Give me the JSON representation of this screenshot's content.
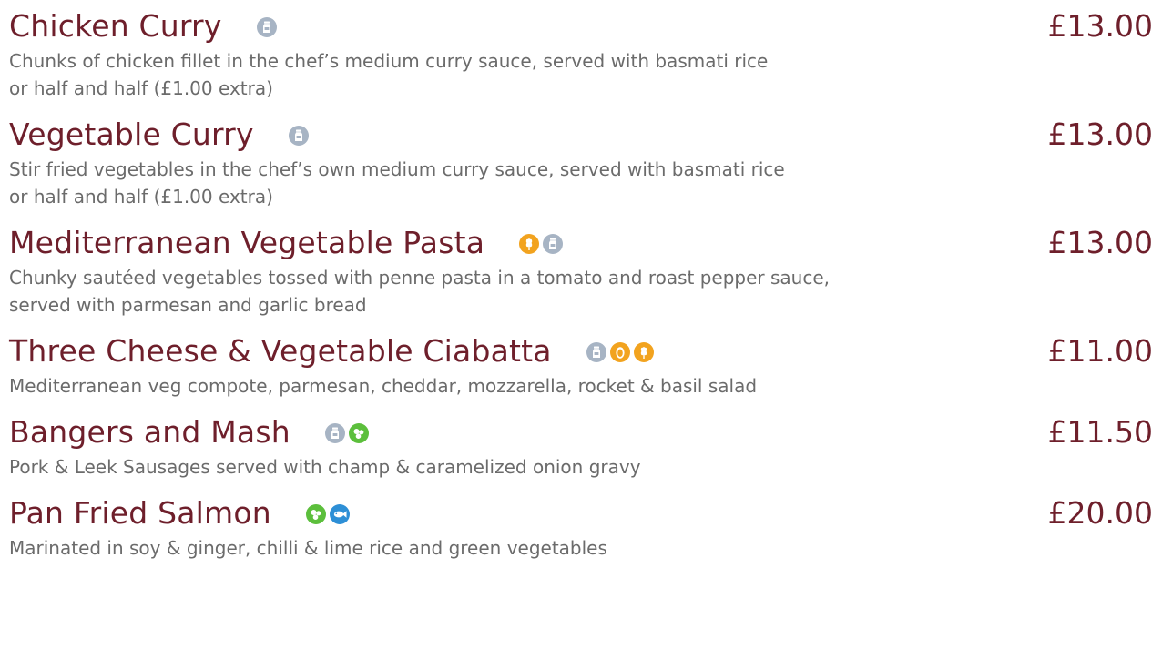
{
  "menu": {
    "items": [
      {
        "name": "Chicken Curry",
        "price": "£13.00",
        "description": "Chunks of chicken fillet in the chef’s medium curry sauce, served with basmati rice\nor half and half (£1.00 extra)",
        "allergens": [
          "milk-icon"
        ]
      },
      {
        "name": "Vegetable Curry",
        "price": "£13.00",
        "description": "Stir fried vegetables in the chef’s own medium curry sauce, served with basmati rice\nor half and half (£1.00 extra)",
        "allergens": [
          "milk-icon"
        ]
      },
      {
        "name": "Mediterranean Vegetable Pasta",
        "price": "£13.00",
        "description": "Chunky sautéed vegetables tossed with penne pasta in a tomato and roast pepper sauce,\nserved with parmesan and garlic bread",
        "allergens": [
          "gluten-icon",
          "milk-icon"
        ]
      },
      {
        "name": "Three Cheese & Vegetable Ciabatta",
        "price": "£11.00",
        "description": "Mediterranean veg compote, parmesan, cheddar, mozzarella, rocket & basil salad",
        "allergens": [
          "milk-icon",
          "egg-icon",
          "gluten-icon"
        ]
      },
      {
        "name": "Bangers and Mash",
        "price": "£11.50",
        "description": "Pork & Leek Sausages served with champ & caramelized onion gravy",
        "allergens": [
          "milk-icon",
          "mustard-icon"
        ]
      },
      {
        "name": "Pan Fried Salmon",
        "price": "£20.00",
        "description": "Marinated in soy & ginger, chilli & lime rice and green vegetables",
        "allergens": [
          "mustard-icon",
          "fish-icon"
        ]
      }
    ]
  },
  "colors": {
    "dish_name": "#6e1f2b",
    "description": "#6b6b6b",
    "milk": "#a7b4c4",
    "gluten": "#f2a31f",
    "egg": "#f2a31f",
    "mustard": "#5cbf3c",
    "fish": "#2d8fd6"
  }
}
